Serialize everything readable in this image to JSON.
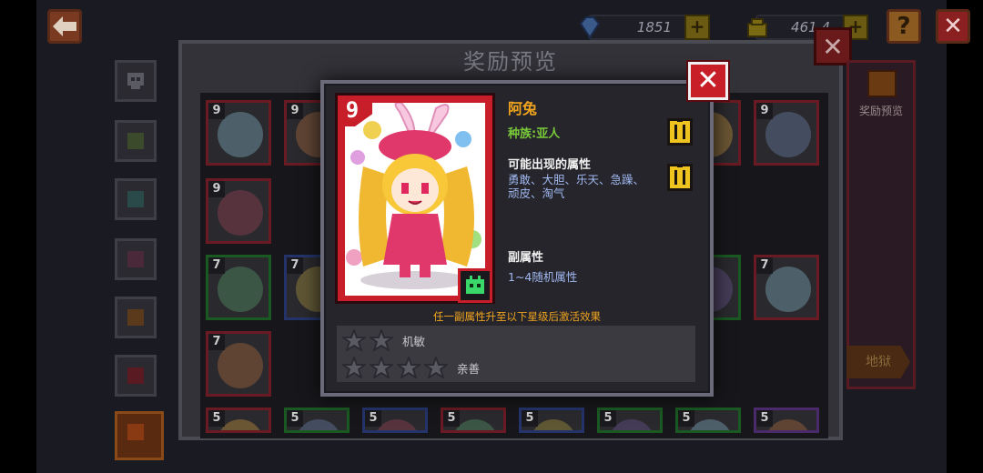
{
  "header": {
    "gem_count": "1851",
    "gold_count": "461.4",
    "back_icon": "arrow-left-icon",
    "help_label": "?",
    "close_label": "✕"
  },
  "background_panel": {
    "title": "奖励预览",
    "right_banner_label": "奖励预览",
    "hell_button": "地狱",
    "grid": [
      {
        "level": "9",
        "color": "red"
      },
      {
        "level": "9",
        "color": "red"
      },
      {
        "level": "9",
        "color": "red"
      },
      {
        "level": "9",
        "color": "red"
      },
      {
        "level": "9",
        "color": "red"
      },
      {
        "level": "7",
        "color": "green"
      },
      {
        "level": "7",
        "color": "blue"
      },
      {
        "level": "7",
        "color": "green"
      },
      {
        "level": "7",
        "color": "red"
      },
      {
        "level": "7",
        "color": "red"
      },
      {
        "level": "5",
        "color": "red"
      },
      {
        "level": "5",
        "color": "green"
      },
      {
        "level": "5",
        "color": "blue"
      },
      {
        "level": "5",
        "color": "red"
      },
      {
        "level": "5",
        "color": "blue"
      },
      {
        "level": "5",
        "color": "green"
      },
      {
        "level": "5",
        "color": "green"
      },
      {
        "level": "5",
        "color": "purple"
      }
    ]
  },
  "modal": {
    "close_label": "✕",
    "card": {
      "level": "9",
      "race_icon": "alien-head-icon"
    },
    "name": "阿兔",
    "race": "种族:亚人",
    "attributes_title": "可能出现的属性",
    "attributes_value": "勇敢、大胆、乐天、急躁、顽皮、淘气",
    "sub_attributes_title": "副属性",
    "sub_attributes_value": "1~4随机属性",
    "activate_note": "任一副属性升至以下星级后激活效果",
    "star_rows": [
      {
        "stars": 2,
        "label": "机敏"
      },
      {
        "stars": 4,
        "label": "亲善"
      }
    ]
  },
  "colors": {
    "accent_orange": "#f0a41e",
    "race_green": "#78c83a",
    "attr_blue": "#a0b8f0",
    "close_red": "#c81e28",
    "info_yellow": "#f0c41e"
  }
}
